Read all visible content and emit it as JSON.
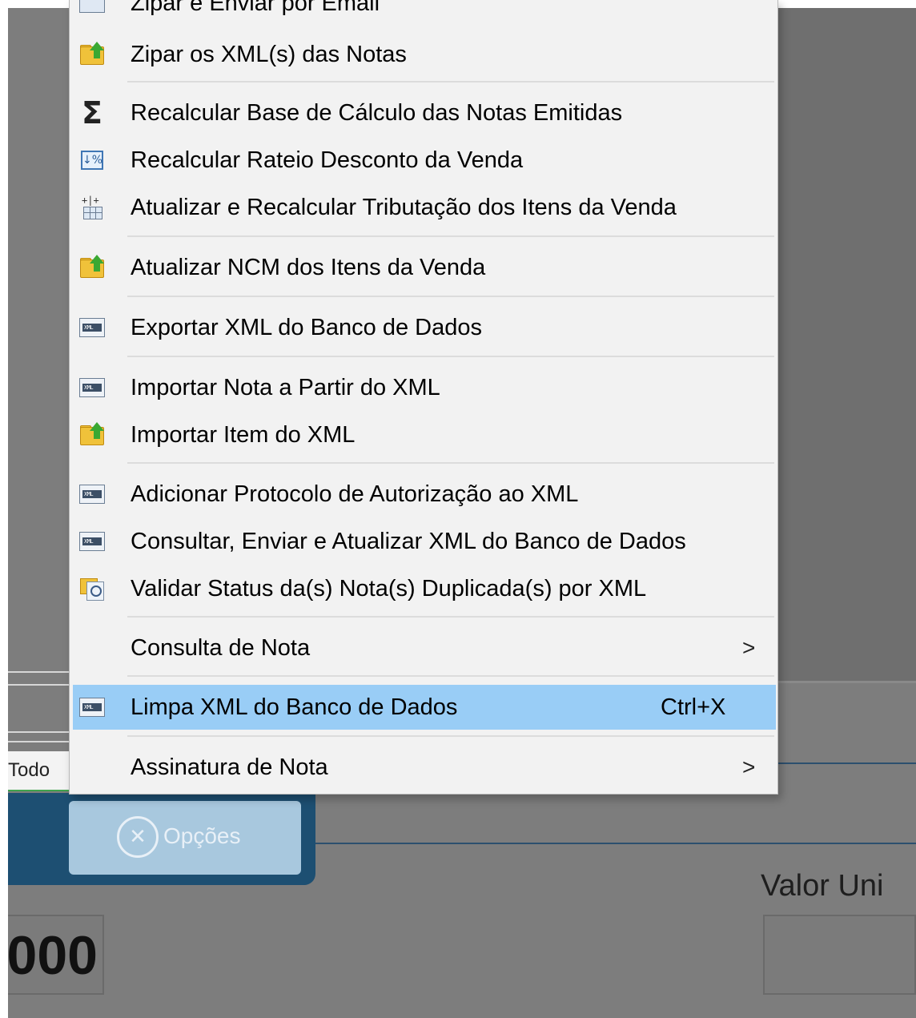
{
  "menu": {
    "items": [
      {
        "label": "Zipar e Enviar por Email",
        "icon": "zip-email-icon"
      },
      {
        "label": "Zipar os XML(s) das Notas",
        "icon": "folder-up-icon"
      },
      {
        "label": "Recalcular Base de Cálculo das Notas Emitidas",
        "icon": "sigma-icon"
      },
      {
        "label": "Recalcular Rateio Desconto da Venda",
        "icon": "percent-icon"
      },
      {
        "label": "Atualizar e Recalcular Tributação dos Itens da Venda",
        "icon": "tax-grid-icon"
      },
      {
        "label": "Atualizar NCM dos Itens da Venda",
        "icon": "folder-up-icon"
      },
      {
        "label": "Exportar XML do Banco de Dados",
        "icon": "xml-icon"
      },
      {
        "label": "Importar Nota a Partir do XML",
        "icon": "xml-icon"
      },
      {
        "label": "Importar Item do XML",
        "icon": "folder-up-icon"
      },
      {
        "label": "Adicionar Protocolo de Autorização ao XML",
        "icon": "xml-icon"
      },
      {
        "label": "Consultar, Enviar e Atualizar XML do Banco de Dados",
        "icon": "xml-icon"
      },
      {
        "label": "Validar Status da(s) Nota(s) Duplicada(s) por XML",
        "icon": "validate-search-icon"
      },
      {
        "label": "Consulta de Nota",
        "submenu_arrow": ">"
      },
      {
        "label": "Limpa XML do Banco de Dados",
        "shortcut": "Ctrl+X",
        "icon": "xml-icon",
        "highlighted": true
      },
      {
        "label": "Assinatura de Nota",
        "submenu_arrow": ">"
      }
    ]
  },
  "background": {
    "tab_label": "Todo",
    "options_button": "Opções",
    "valor_label": "Valor Uni",
    "total_value": "000"
  },
  "colors": {
    "menu_bg": "#f2f2f2",
    "highlight": "#99cdf6",
    "overlay": "#7d7d7d",
    "panel_blue": "#1d4f72"
  }
}
